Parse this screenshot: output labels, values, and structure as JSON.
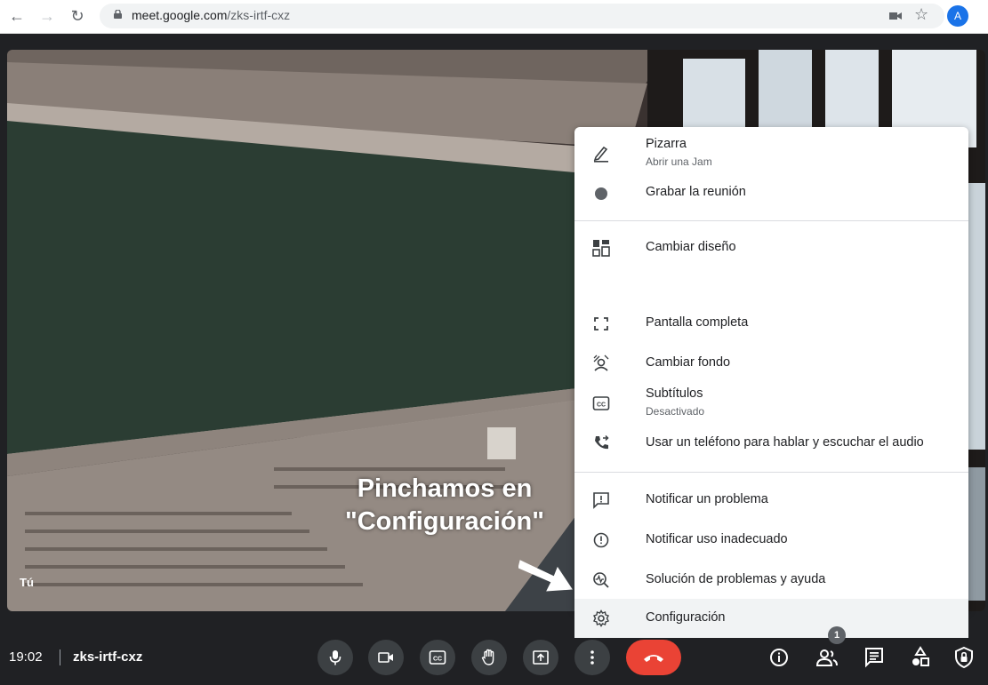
{
  "browser": {
    "url_host": "meet.google.com",
    "url_path": "/zks-irtf-cxz",
    "profile_initial": "A"
  },
  "video": {
    "self_label": "Tú"
  },
  "annotation": {
    "line1": "Pinchamos en",
    "line2": "\"Configuración\""
  },
  "menu": {
    "items": [
      {
        "label": "Pizarra",
        "sub": "Abrir una Jam",
        "icon": "pencil-icon"
      },
      {
        "label": "Grabar la reunión",
        "icon": "record-dot-icon"
      },
      {
        "label": "Cambiar diseño",
        "icon": "layout-icon"
      },
      {
        "label": "Pantalla completa",
        "icon": "fullscreen-icon"
      },
      {
        "label": "Cambiar fondo",
        "icon": "background-icon"
      },
      {
        "label": "Subtítulos",
        "sub": "Desactivado",
        "icon": "captions-icon"
      },
      {
        "label": "Usar un teléfono para hablar y escuchar el audio",
        "icon": "phone-forward-icon"
      },
      {
        "label": "Notificar un problema",
        "icon": "report-problem-icon"
      },
      {
        "label": "Notificar uso inadecuado",
        "icon": "report-abuse-icon"
      },
      {
        "label": "Solución de problemas y ayuda",
        "icon": "troubleshoot-icon"
      },
      {
        "label": "Configuración",
        "icon": "gear-icon"
      }
    ]
  },
  "bottom_bar": {
    "time": "19:02",
    "meeting_code": "zks-irtf-cxz",
    "participants_count": "1"
  },
  "colors": {
    "hangup": "#ea4335",
    "bar_bg": "#202124",
    "control_bg": "#3c4043",
    "avatar": "#1a73e8"
  }
}
